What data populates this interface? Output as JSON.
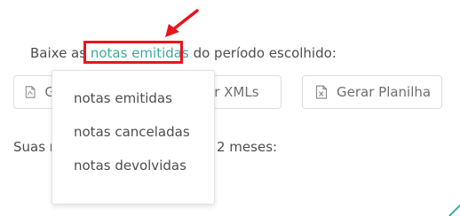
{
  "intro": {
    "prefix": "Baixe as",
    "link": "notas emitidas",
    "suffix": "do período escolhido:"
  },
  "buttons": {
    "download_partial": "G",
    "xml_partial": "ar XMLs",
    "spreadsheet": "Gerar Planilha"
  },
  "hint": {
    "prefix": "Suas n",
    "suffix": "2 meses:"
  },
  "dropdown": {
    "items": [
      "notas emitidas",
      "notas canceladas",
      "notas devolvidas"
    ]
  },
  "icons": {
    "pdf": "file-pdf-icon",
    "excel": "file-excel-icon"
  },
  "colors": {
    "accent": "#3fa89b",
    "annotation": "#e8141e"
  }
}
